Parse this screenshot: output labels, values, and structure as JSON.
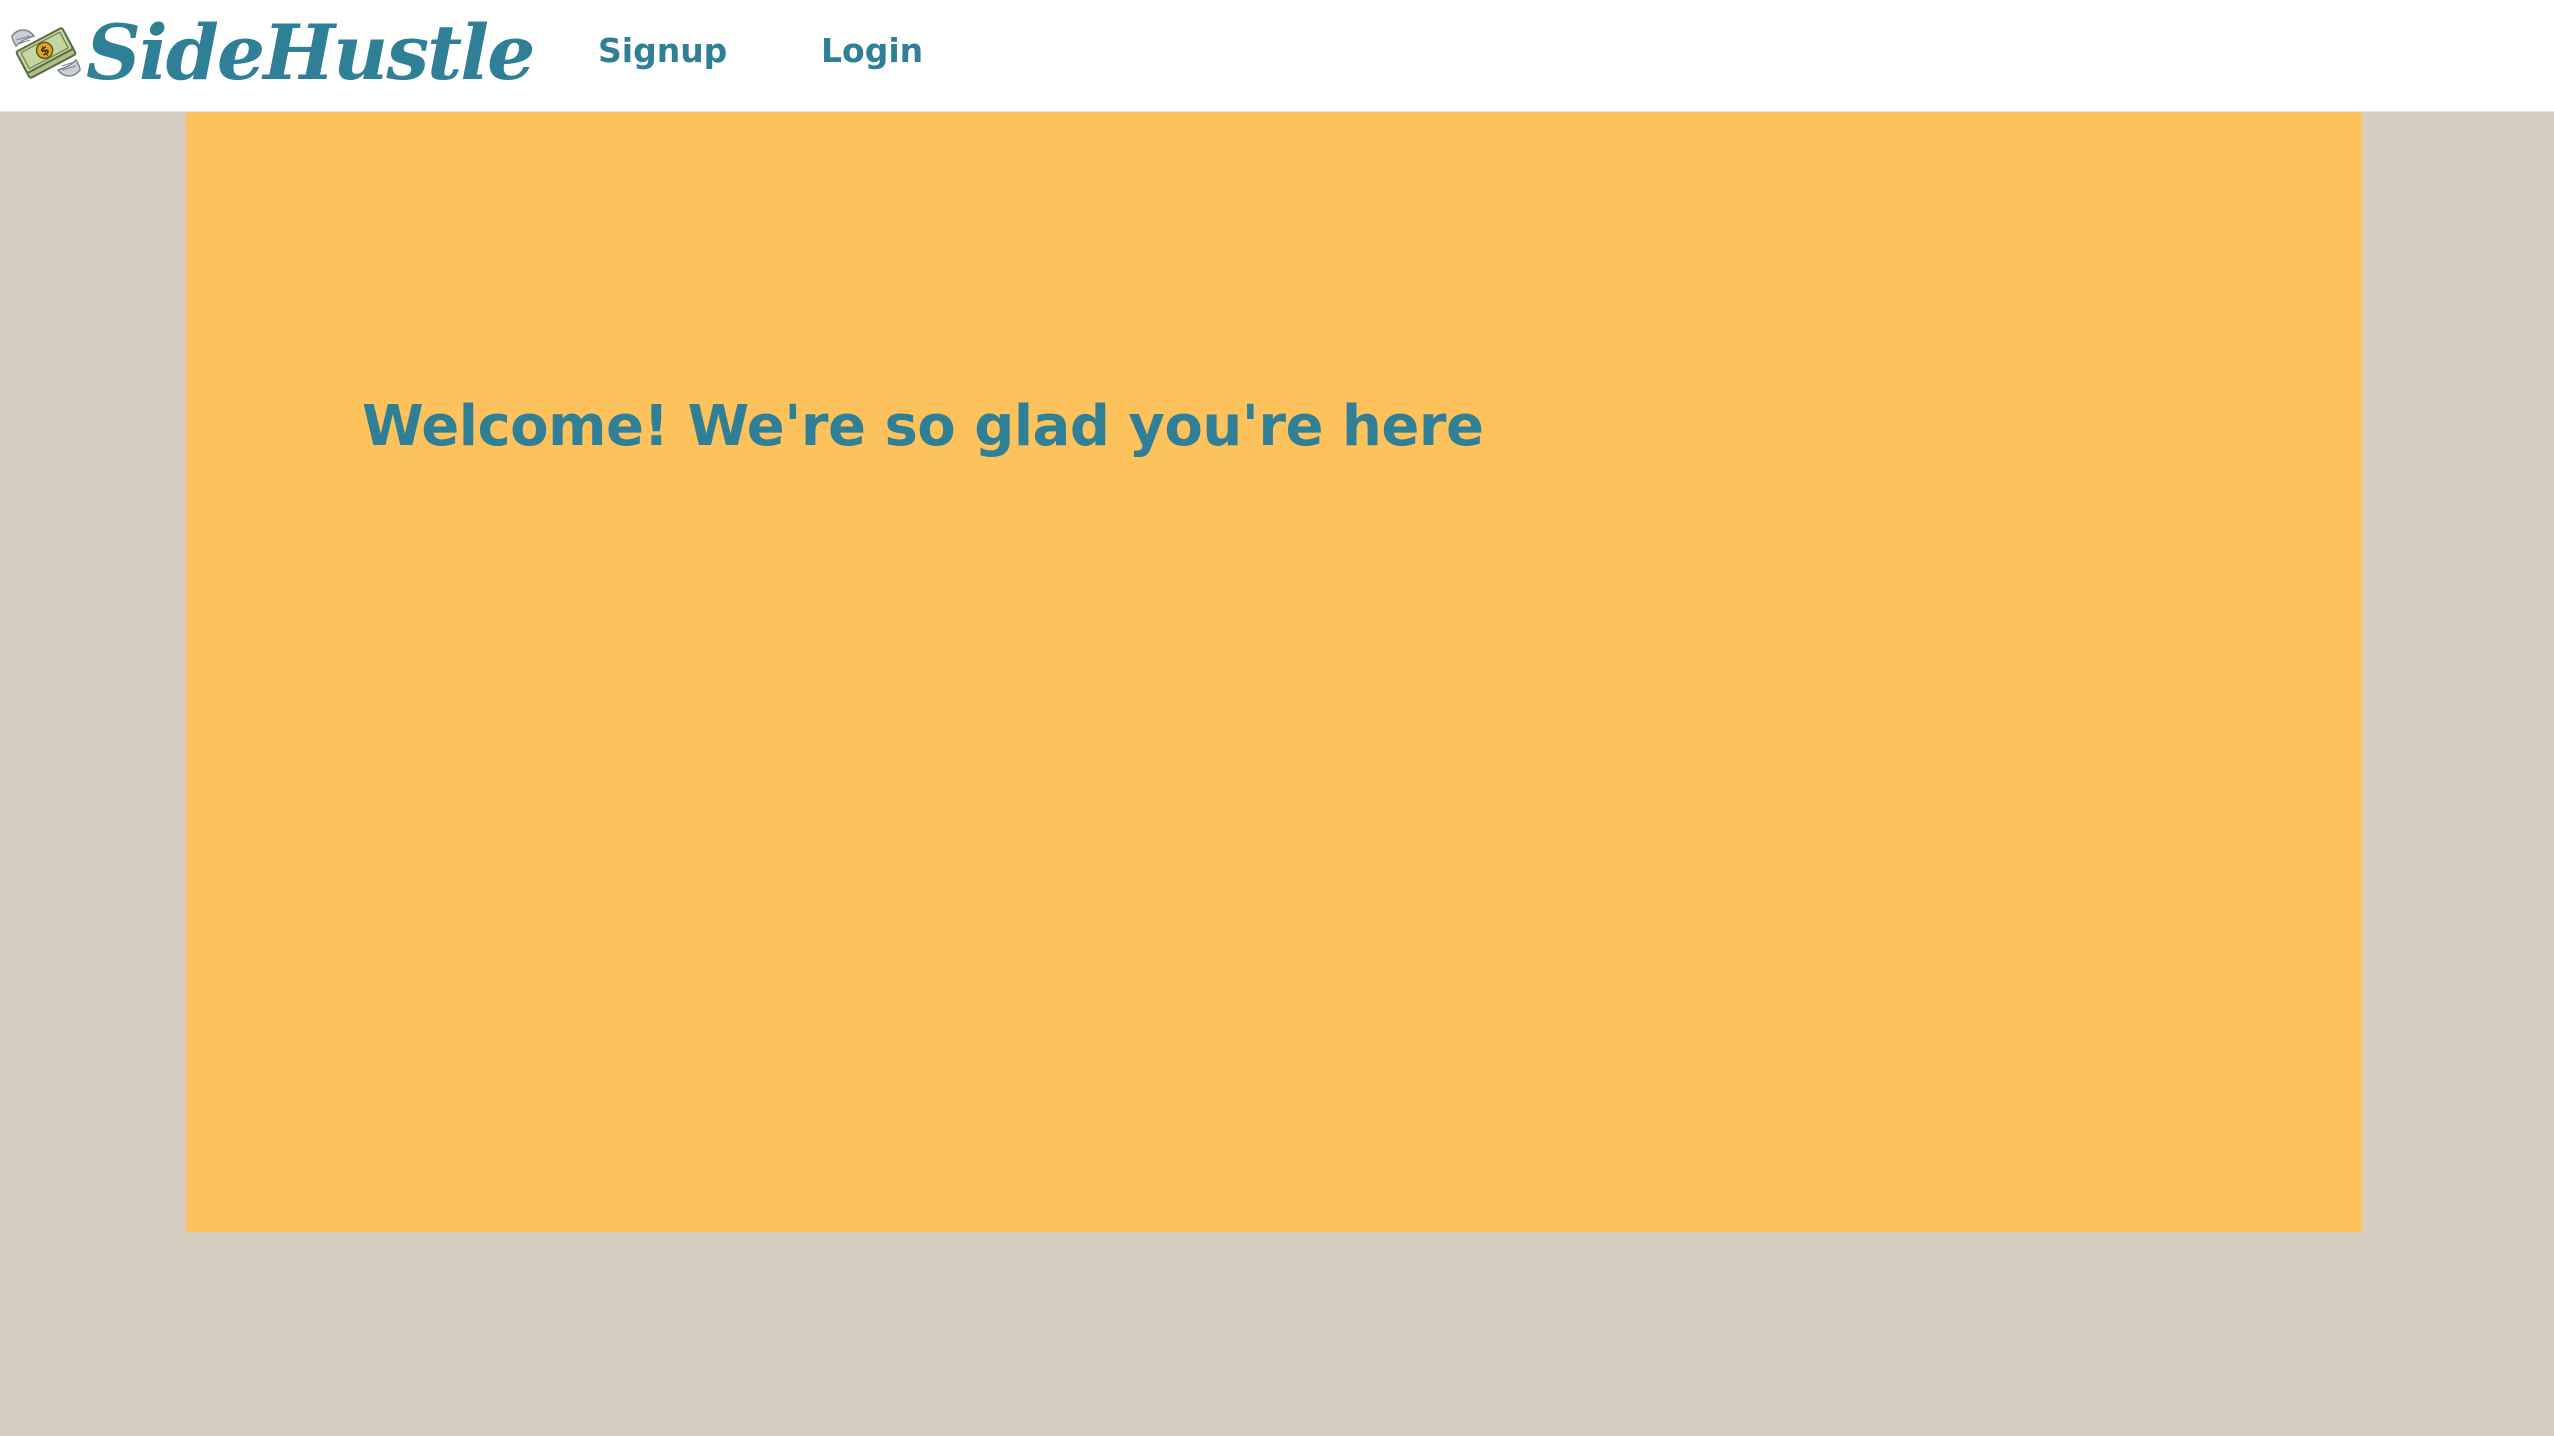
{
  "header": {
    "logo_text": "SideHustle",
    "logo_icon": "money-with-wings-icon",
    "nav": {
      "signup_label": "Signup",
      "login_label": "Login"
    }
  },
  "hero": {
    "title": "Welcome! We're so glad you're here"
  },
  "colors": {
    "brand": "#2f7f97",
    "hero_background": "#fec25c",
    "page_background": "#d6cec3",
    "header_background": "#ffffff"
  }
}
